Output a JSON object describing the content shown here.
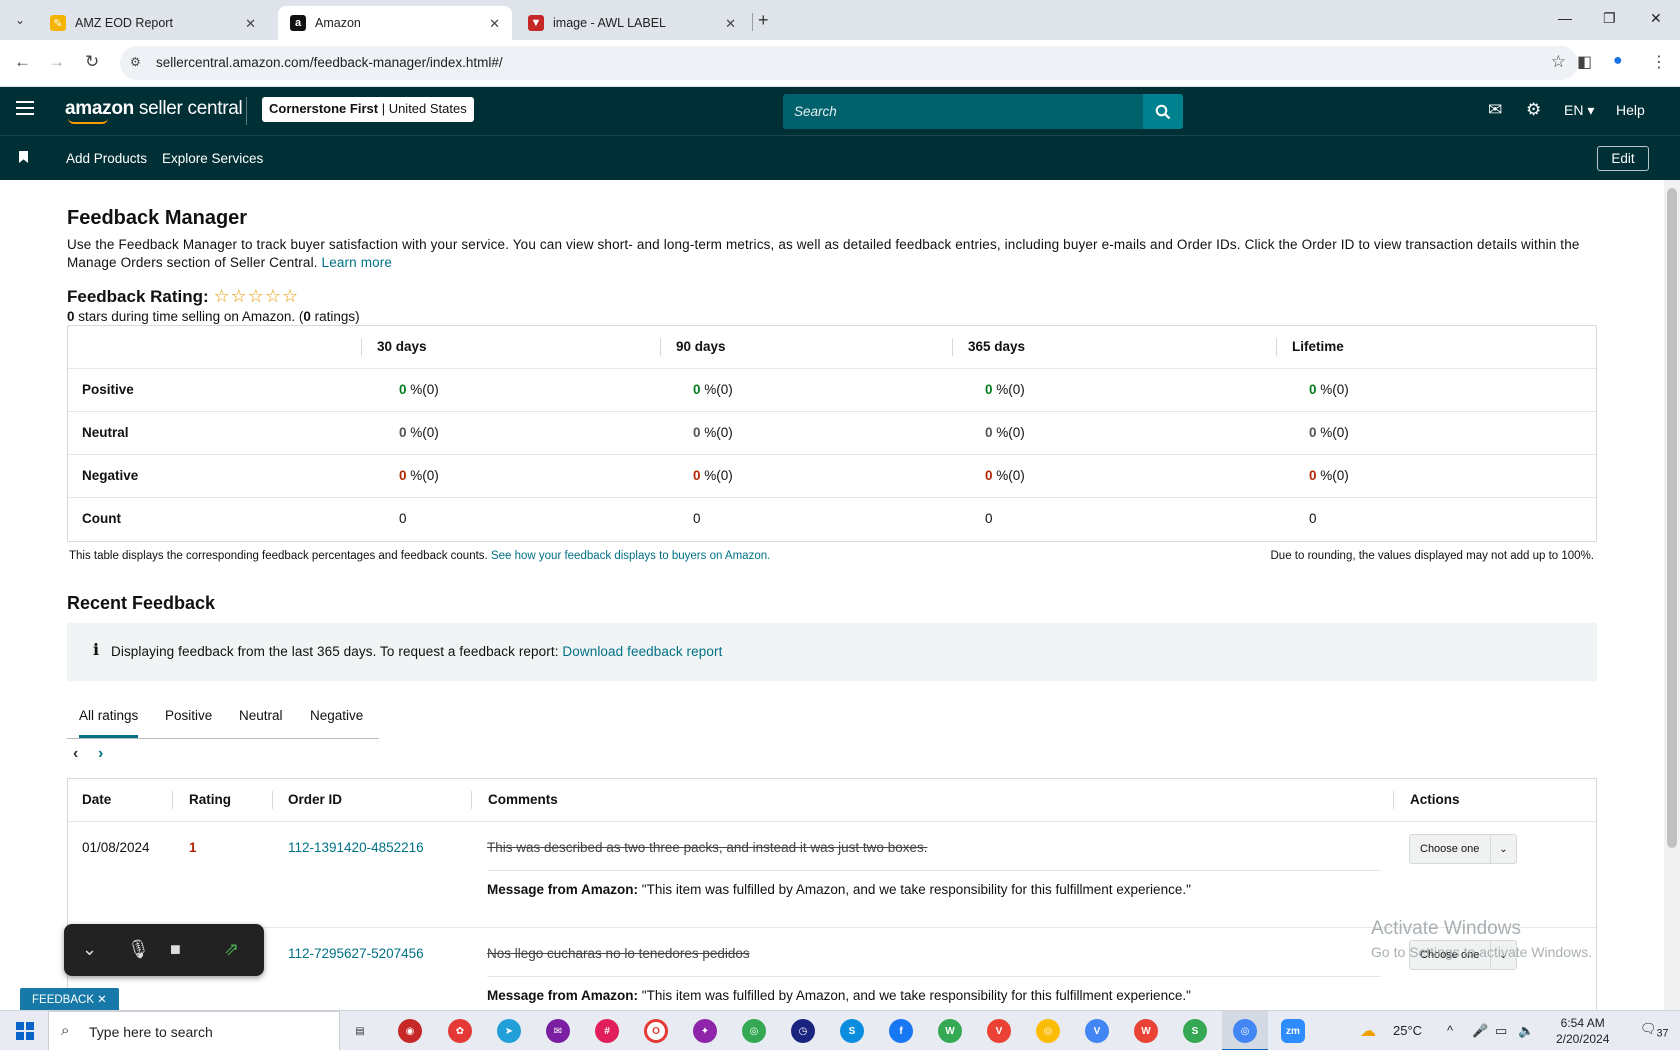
{
  "browser": {
    "tabs": [
      {
        "title": "AMZ EOD Report",
        "favicon": "sheets-pencil-icon"
      },
      {
        "title": "Amazon",
        "favicon": "amazon-a-icon"
      },
      {
        "title": "image - AWL LABEL",
        "favicon": "awl-label-icon"
      }
    ],
    "url": "sellercentral.amazon.com/feedback-manager/index.html#/"
  },
  "header": {
    "logo_main": "amazon",
    "logo_sub": " seller central",
    "store_name": "Cornerstone First",
    "store_sep": " | ",
    "store_region": "United States",
    "search_placeholder": "Search",
    "language": "EN",
    "help": "Help"
  },
  "subnav": {
    "links": [
      "Add Products",
      "Explore Services"
    ],
    "edit": "Edit"
  },
  "page": {
    "title": "Feedback Manager",
    "intro": "Use the Feedback Manager to track buyer satisfaction with your service. You can view short- and long-term metrics, as well as detailed feedback entries, including buyer e-mails and Order IDs. Click the Order ID to view transaction details within the Manage Orders section of Seller Central.",
    "learn_more": "Learn more",
    "rating_label": "Feedback Rating:",
    "stars_display": "☆☆☆☆☆",
    "stars_count": "0",
    "stars_text_mid": " stars during time selling on Amazon. (",
    "ratings_count": "0",
    "ratings_suffix": " ratings)"
  },
  "metrics": {
    "columns": [
      "30 days",
      "90 days",
      "365 days",
      "Lifetime"
    ],
    "rows": [
      {
        "label": "Positive",
        "values": [
          "0",
          "0",
          "0",
          "0"
        ],
        "suffix": " %(0)",
        "tone": "positive"
      },
      {
        "label": "Neutral",
        "values": [
          "0",
          "0",
          "0",
          "0"
        ],
        "suffix": " %(0)",
        "tone": "neutral"
      },
      {
        "label": "Negative",
        "values": [
          "0",
          "0",
          "0",
          "0"
        ],
        "suffix": " %(0)",
        "tone": "negative"
      },
      {
        "label": "Count",
        "values": [
          "0",
          "0",
          "0",
          "0"
        ],
        "suffix": "",
        "tone": "plain"
      }
    ],
    "note_left": "This table displays the corresponding feedback percentages and feedback counts.",
    "note_link": "See how your feedback displays to buyers on Amazon.",
    "note_right": "Due to rounding, the values displayed may not add up to 100%."
  },
  "recent": {
    "title": "Recent Feedback",
    "info_text": "Displaying feedback from the last 365 days. To request a feedback report:",
    "info_link": "Download feedback report",
    "tabs": [
      "All ratings",
      "Positive",
      "Neutral",
      "Negative"
    ],
    "columns": {
      "date": "Date",
      "rating": "Rating",
      "order": "Order ID",
      "comments": "Comments",
      "actions": "Actions"
    },
    "rows": [
      {
        "date": "01/08/2024",
        "rating": "1",
        "order_id": "112-1391420-4852216",
        "comment": "This was described as two three packs, and instead it was just two boxes.",
        "message_label": "Message from Amazon:",
        "message": "\"This item was fulfilled by Amazon, and we take responsibility for this fulfillment experience.\"",
        "action": "Choose one"
      },
      {
        "date": "",
        "rating": "",
        "order_id": "112-7295627-5207456",
        "comment": "Nos llego cucharas no lo tenedores pedidos",
        "message_label": "Message from Amazon:",
        "message": "\"This item was fulfilled by Amazon, and we take responsibility for this fulfillment experience.\"",
        "action": "Choose one"
      }
    ]
  },
  "overlay": {
    "watermark_title": "Activate Windows",
    "watermark_sub": "Go to Settings to activate Windows.",
    "feedback_badge": "FEEDBACK ✕"
  },
  "taskbar": {
    "search_placeholder": "Type here to search",
    "temperature": "25°C",
    "time": "6:54 AM",
    "date": "2/20/2024",
    "notifications": "37"
  },
  "colors": {
    "header_bg": "#002f36",
    "link": "#007185",
    "positive": "#067d1e",
    "negative": "#b12704",
    "star": "#e59d00"
  }
}
